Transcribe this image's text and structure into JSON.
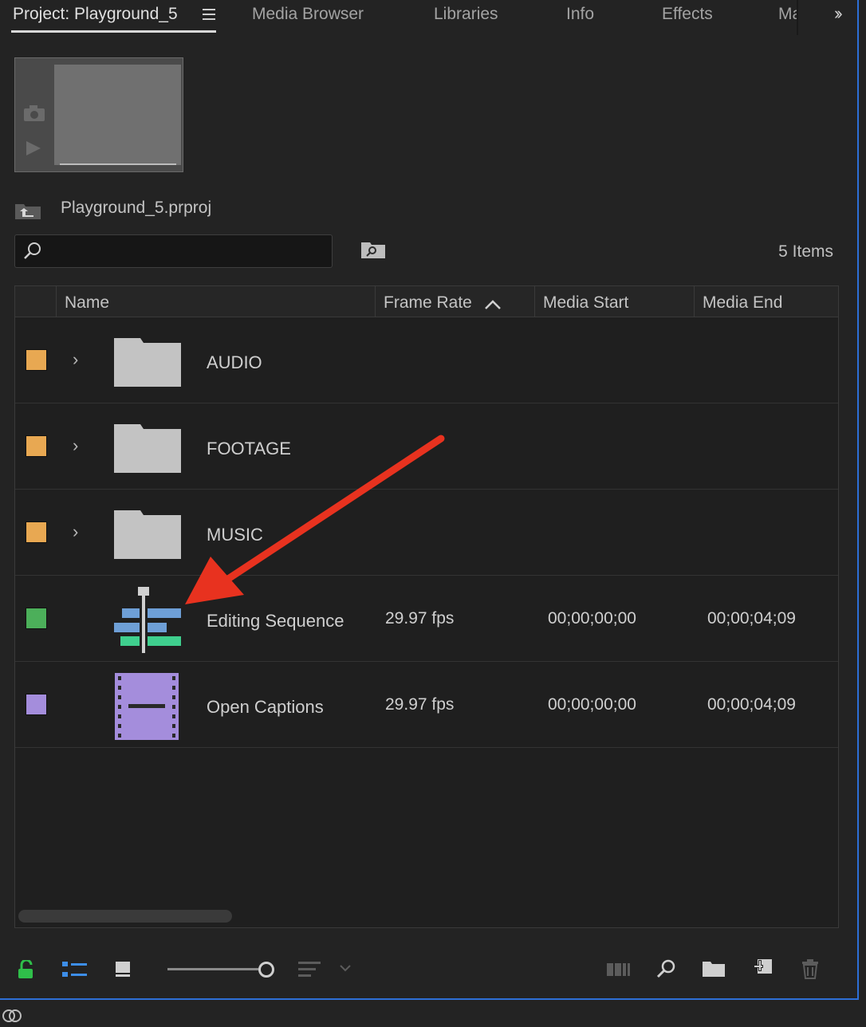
{
  "tabs": [
    {
      "label": "Project: Playground_5"
    },
    {
      "label": "Media Browser"
    },
    {
      "label": "Libraries"
    },
    {
      "label": "Info"
    },
    {
      "label": "Effects"
    },
    {
      "label": "Ma"
    }
  ],
  "project": {
    "file_name": "Playground_5.prproj",
    "items_count": "5 Items"
  },
  "search": {
    "placeholder": ""
  },
  "table": {
    "headers": {
      "name": "Name",
      "frame_rate": "Frame Rate",
      "media_start": "Media Start",
      "media_end": "Media End"
    },
    "rows": [
      {
        "name": "AUDIO",
        "type": "folder",
        "label_color": "#e8a852",
        "frame_rate": "",
        "media_start": "",
        "media_end": ""
      },
      {
        "name": "FOOTAGE",
        "type": "folder",
        "label_color": "#e8a852",
        "frame_rate": "",
        "media_start": "",
        "media_end": ""
      },
      {
        "name": "MUSIC",
        "type": "folder",
        "label_color": "#e8a852",
        "frame_rate": "",
        "media_start": "",
        "media_end": ""
      },
      {
        "name": "Editing Sequence",
        "type": "sequence",
        "label_color": "#4caf5a",
        "frame_rate": "29.97 fps",
        "media_start": "00;00;00;00",
        "media_end": "00;00;04;09"
      },
      {
        "name": "Open Captions",
        "type": "captions",
        "label_color": "#a48ddc",
        "frame_rate": "29.97 fps",
        "media_start": "00;00;00;00",
        "media_end": "00;00;04;09"
      }
    ]
  },
  "colors": {
    "accent": "#2d6fd6",
    "annotation_arrow": "#e8321f"
  }
}
